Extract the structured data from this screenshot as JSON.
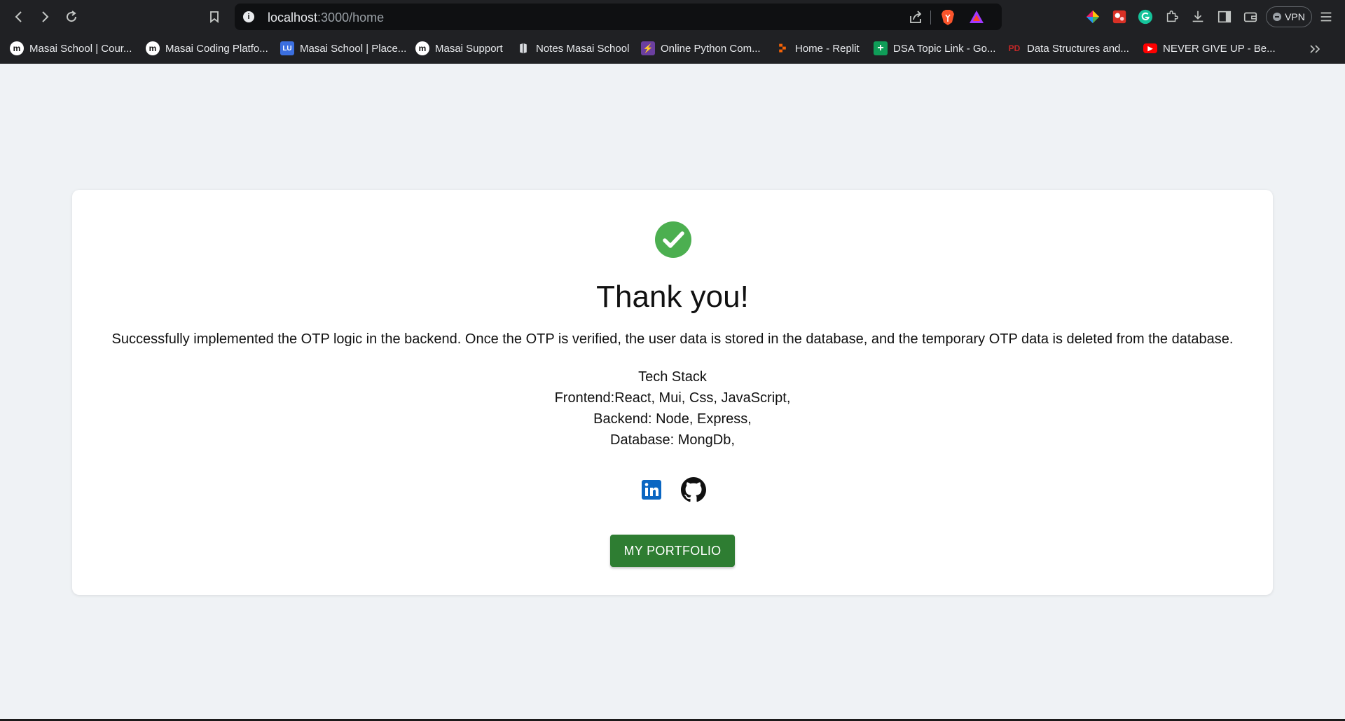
{
  "browser": {
    "url_host": "localhost",
    "url_path": ":3000/home",
    "vpn_label": "VPN",
    "bookmarks": [
      {
        "label": "Masai School | Cour...",
        "icon": "masai-icon",
        "icon_text": "m"
      },
      {
        "label": "Masai Coding Platfo...",
        "icon": "masai-icon",
        "icon_text": "m"
      },
      {
        "label": "Masai School | Place...",
        "icon": "lu-icon",
        "icon_text": "LU"
      },
      {
        "label": "Masai Support",
        "icon": "masai-icon",
        "icon_text": "m"
      },
      {
        "label": "Notes Masai School",
        "icon": "notes-icon",
        "icon_text": ""
      },
      {
        "label": "Online Python Com...",
        "icon": "python-icon",
        "icon_text": "⚡"
      },
      {
        "label": "Home - Replit",
        "icon": "replit-icon",
        "icon_text": ""
      },
      {
        "label": "DSA Topic Link - Go...",
        "icon": "sheets-icon",
        "icon_text": "+"
      },
      {
        "label": "Data Structures and...",
        "icon": "pdf-icon",
        "icon_text": "PD"
      },
      {
        "label": "NEVER GIVE UP - Be...",
        "icon": "youtube-icon",
        "icon_text": "▶"
      }
    ]
  },
  "card": {
    "title": "Thank you!",
    "description": "Successfully implemented the OTP logic in the backend. Once the OTP is verified, the user data is stored in the database, and the temporary OTP data is deleted from the database.",
    "stack_heading": "Tech Stack",
    "stack_frontend": "Frontend:React, Mui, Css, JavaScript,",
    "stack_backend": "Backend: Node, Express,",
    "stack_database": "Database: MongDb,",
    "button_label": "MY PORTFOLIO"
  },
  "colors": {
    "success": "#4caf50",
    "button": "#2e7d32",
    "linkedin": "#0a66c2",
    "page_bg": "#eff2f5"
  }
}
